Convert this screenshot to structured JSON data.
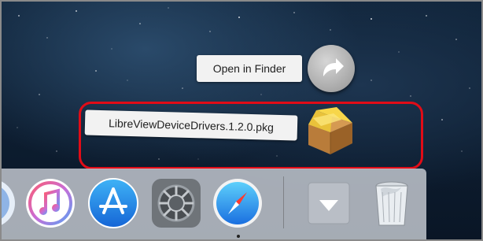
{
  "context_menu": {
    "open_in_finder_label": "Open in Finder",
    "file_name_label": "LibreViewDeviceDrivers.1.2.0.pkg"
  },
  "icons": {
    "share": "share-arrow-icon",
    "package": "package-icon",
    "itunes": "itunes-icon",
    "app_store": "app-store-icon",
    "system_preferences": "system-preferences-icon",
    "safari": "safari-icon",
    "downloads_stack": "downloads-stack-icon",
    "trash": "trash-icon"
  },
  "colors": {
    "highlight": "#e10c17",
    "desktop": "#10243a",
    "dock": "#c8cdd4"
  }
}
